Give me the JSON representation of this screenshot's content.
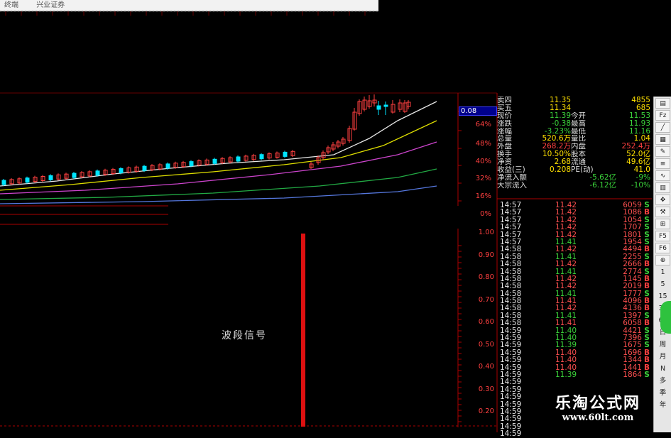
{
  "window": {
    "title_left": "终端",
    "broker": "兴业证券"
  },
  "price_axis": {
    "current_box": "0.08",
    "labels": [
      "64%",
      "48%",
      "40%",
      "32%",
      "16%",
      "0%"
    ]
  },
  "indicator": {
    "name": "波段信号",
    "axis_labels": [
      "1.00",
      "0.90",
      "0.80",
      "0.70",
      "0.60",
      "0.50",
      "0.40",
      "0.30",
      "0.20"
    ]
  },
  "quote": {
    "rows": [
      {
        "l1": "卖四",
        "v1": "11.35",
        "l2": "",
        "v2": "4855",
        "c1": "#ffe000"
      },
      {
        "l1": "买五",
        "v1": "11.34",
        "l2": "",
        "v2": "685",
        "c1": "#ffe000"
      },
      {
        "l1": "现价",
        "v1": "11.39",
        "l2": "今开",
        "v2": "11.53",
        "c1": "#3ad23a"
      },
      {
        "l1": "涨跌",
        "v1": "-0.38",
        "l2": "最高",
        "v2": "11.93",
        "c1": "#3ad23a"
      },
      {
        "l1": "涨幅",
        "v1": "-3.23%",
        "l2": "最低",
        "v2": "11.16",
        "c1": "#3ad23a"
      },
      {
        "l1": "总量",
        "v1": "520.6万",
        "l2": "量比",
        "v2": "1.04",
        "c1": "#ffe000"
      },
      {
        "l1": "外盘",
        "v1": "268.2万",
        "l2": "内盘",
        "v2": "252.4万",
        "c1": "#ff4040"
      },
      {
        "l1": "换手",
        "v1": "10.50%",
        "l2": "股本",
        "v2": "52.0亿",
        "c1": "#ffe000"
      },
      {
        "l1": "净资",
        "v1": "2.68",
        "l2": "流通",
        "v2": "49.6亿",
        "c1": "#ffe000"
      },
      {
        "l1": "收益(三)",
        "v1": "0.208",
        "l2": "PE(动)",
        "v2": "41.0",
        "c1": "#ffe000"
      },
      {
        "l1": "净流入额",
        "v1": "",
        "l2": "-5.62亿",
        "v2": "-9%",
        "c1": "#3ad23a"
      },
      {
        "l1": "大宗流入",
        "v1": "",
        "l2": "-6.12亿",
        "v2": "-10%",
        "c1": "#3ad23a"
      }
    ]
  },
  "ticks": [
    {
      "t": "14:57",
      "p": "11.42",
      "v": "6059",
      "d": "S"
    },
    {
      "t": "14:57",
      "p": "11.42",
      "v": "1086",
      "d": "B"
    },
    {
      "t": "14:57",
      "p": "11.42",
      "v": "1054",
      "d": "S"
    },
    {
      "t": "14:57",
      "p": "11.42",
      "v": "1707",
      "d": "S"
    },
    {
      "t": "14:57",
      "p": "11.42",
      "v": "1801",
      "d": "S"
    },
    {
      "t": "14:57",
      "p": "11.41",
      "v": "1954",
      "d": "S"
    },
    {
      "t": "14:58",
      "p": "11.42",
      "v": "4494",
      "d": "B"
    },
    {
      "t": "14:58",
      "p": "11.41",
      "v": "2255",
      "d": "S"
    },
    {
      "t": "14:58",
      "p": "11.42",
      "v": "2666",
      "d": "B"
    },
    {
      "t": "14:58",
      "p": "11.41",
      "v": "2774",
      "d": "S"
    },
    {
      "t": "14:58",
      "p": "11.42",
      "v": "1145",
      "d": "B"
    },
    {
      "t": "14:58",
      "p": "11.42",
      "v": "2019",
      "d": "B"
    },
    {
      "t": "14:58",
      "p": "11.41",
      "v": "1777",
      "d": "S"
    },
    {
      "t": "14:58",
      "p": "11.41",
      "v": "4096",
      "d": "B"
    },
    {
      "t": "14:58",
      "p": "11.42",
      "v": "4136",
      "d": "B"
    },
    {
      "t": "14:58",
      "p": "11.41",
      "v": "1397",
      "d": "S"
    },
    {
      "t": "14:58",
      "p": "11.41",
      "v": "6058",
      "d": "B"
    },
    {
      "t": "14:59",
      "p": "11.40",
      "v": "4421",
      "d": "S"
    },
    {
      "t": "14:59",
      "p": "11.40",
      "v": "7396",
      "d": "S"
    },
    {
      "t": "14:59",
      "p": "11.39",
      "v": "1675",
      "d": "S"
    },
    {
      "t": "14:59",
      "p": "11.40",
      "v": "1696",
      "d": "B"
    },
    {
      "t": "14:59",
      "p": "11.40",
      "v": "1344",
      "d": "B"
    },
    {
      "t": "14:59",
      "p": "11.40",
      "v": "1441",
      "d": "B"
    },
    {
      "t": "14:59",
      "p": "11.39",
      "v": "1864",
      "d": "S"
    },
    {
      "t": "14:59",
      "p": "",
      "v": "",
      "d": ""
    },
    {
      "t": "14:59",
      "p": "",
      "v": "",
      "d": ""
    },
    {
      "t": "14:59",
      "p": "",
      "v": "",
      "d": ""
    },
    {
      "t": "14:59",
      "p": "",
      "v": "",
      "d": ""
    },
    {
      "t": "14:59",
      "p": "",
      "v": "",
      "d": ""
    },
    {
      "t": "14:59",
      "p": "",
      "v": "",
      "d": ""
    },
    {
      "t": "14:59",
      "p": "",
      "v": "",
      "d": ""
    },
    {
      "t": "14:59",
      "p": "",
      "v": "",
      "d": ""
    }
  ],
  "sidebar": {
    "icons": [
      "chart-icon",
      "fz-icon",
      "line-icon",
      "grid-icon",
      "pen-icon",
      "list-icon",
      "wave-icon",
      "bars-icon",
      "move-icon",
      "brush-icon",
      "calc-icon",
      "f5-icon",
      "f6-icon",
      "zoom-icon"
    ],
    "periods": [
      "1",
      "5",
      "15",
      "30",
      "60",
      "日",
      "周",
      "月",
      "N",
      "多",
      "季",
      "年"
    ]
  },
  "watermark": {
    "brand": "乐淘公式网",
    "url": "www.60lt.com"
  },
  "colors": {
    "up": "#ff4040",
    "down": "#00e5ff",
    "ma5": "#ffffff",
    "ma10": "#e6e600",
    "ma20": "#cc44cc",
    "ma60": "#22aa44"
  }
}
